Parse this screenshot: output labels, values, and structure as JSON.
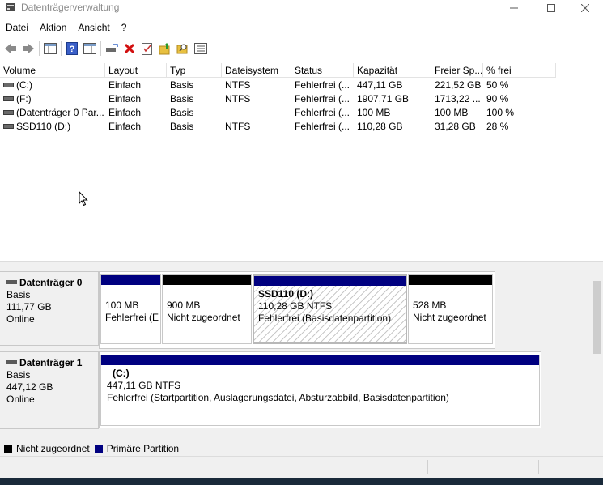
{
  "window": {
    "title": "Datenträgerverwaltung"
  },
  "menu": [
    "Datei",
    "Aktion",
    "Ansicht",
    "?"
  ],
  "toolbar_icons": [
    "back-icon",
    "forward-icon",
    "properties-panel-icon",
    "help-icon",
    "console-tree-icon",
    "connect-drive-icon",
    "delete-icon",
    "checklist-icon",
    "up-folder-icon",
    "search-folder-icon",
    "list-view-icon"
  ],
  "volume_list": {
    "columns": [
      "Volume",
      "Layout",
      "Typ",
      "Dateisystem",
      "Status",
      "Kapazität",
      "Freier Sp...",
      "% frei"
    ],
    "rows": [
      [
        "(C:)",
        "Einfach",
        "Basis",
        "NTFS",
        "Fehlerfrei (...",
        "447,11 GB",
        "221,52 GB",
        "50 %"
      ],
      [
        "(F:)",
        "Einfach",
        "Basis",
        "NTFS",
        "Fehlerfrei (...",
        "1907,71 GB",
        "1713,22 ...",
        "90 %"
      ],
      [
        "(Datenträger 0 Par...",
        "Einfach",
        "Basis",
        "",
        "Fehlerfrei (...",
        "100 MB",
        "100 MB",
        "100 %"
      ],
      [
        "SSD110 (D:)",
        "Einfach",
        "Basis",
        "NTFS",
        "Fehlerfrei (...",
        "110,28 GB",
        "31,28 GB",
        "28 %"
      ]
    ]
  },
  "disks": [
    {
      "name": "Datenträger 0",
      "type": "Basis",
      "size": "111,77 GB",
      "state": "Online",
      "partitions": [
        {
          "title": "",
          "size": "100 MB",
          "status": "Fehlerfrei (E",
          "kind": "primary"
        },
        {
          "title": "",
          "size": "900 MB",
          "status": "Nicht zugeordnet",
          "kind": "unallocated"
        },
        {
          "title": "SSD110  (D:)",
          "size": "110,28 GB NTFS",
          "status": "Fehlerfrei (Basisdatenpartition)",
          "kind": "primary-selected"
        },
        {
          "title": "",
          "size": "528 MB",
          "status": "Nicht zugeordnet",
          "kind": "unallocated"
        }
      ]
    },
    {
      "name": "Datenträger 1",
      "type": "Basis",
      "size": "447,12 GB",
      "state": "Online",
      "partitions": [
        {
          "title": "(C:)",
          "size": "447,11 GB NTFS",
          "status": "Fehlerfrei (Startpartition, Auslagerungsdatei, Absturzabbild, Basisdatenpartition)",
          "kind": "primary"
        }
      ]
    }
  ],
  "legend": [
    {
      "label": "Nicht zugeordnet",
      "color": "#000000"
    },
    {
      "label": "Primäre Partition",
      "color": "#000080"
    }
  ],
  "colors": {
    "primary": "#000080",
    "unallocated": "#000000"
  }
}
